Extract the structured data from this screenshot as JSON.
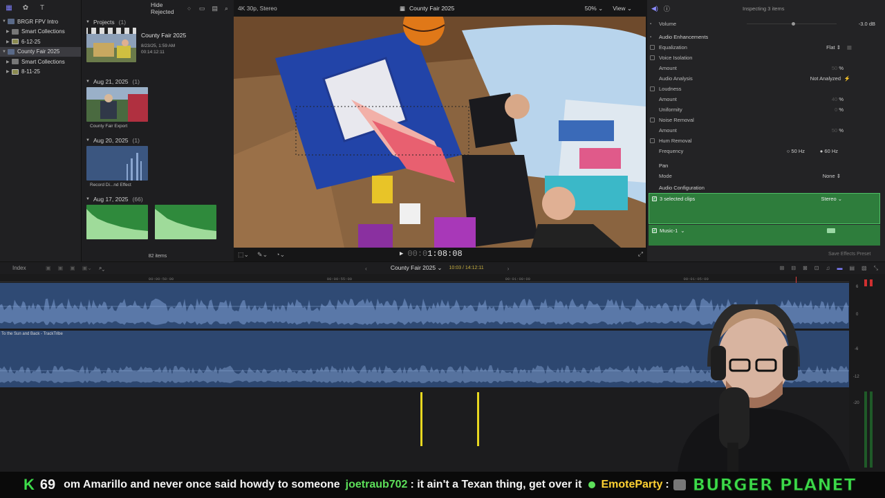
{
  "sidebar": {
    "items": [
      {
        "label": "BRGR FPV Intro",
        "type": "lib",
        "expanded": true
      },
      {
        "label": "Smart Collections",
        "type": "folder",
        "indent": true
      },
      {
        "label": "6-12-25",
        "type": "event",
        "indent": true
      },
      {
        "label": "County Fair 2025",
        "type": "lib",
        "selected": true
      },
      {
        "label": "Smart Collections",
        "type": "folder",
        "indent": true
      },
      {
        "label": "8-11-25",
        "type": "event",
        "indent": true
      }
    ]
  },
  "browser": {
    "hide_rejected": "Hide Rejected",
    "sections": [
      {
        "title": "Projects",
        "count": "(1)"
      },
      {
        "title": "Aug 21, 2025",
        "count": "(1)"
      },
      {
        "title": "Aug 20, 2025",
        "count": "(1)"
      },
      {
        "title": "Aug 17, 2025",
        "count": "(66)"
      }
    ],
    "project": {
      "title": "County Fair 2025",
      "date": "8/23/25, 1:59 AM",
      "duration": "00:14:12:11"
    },
    "clip_aug21": "County Fair Export",
    "clip_aug20": "Record Di...nd Effect",
    "items_count": "82 items"
  },
  "viewer": {
    "format": "4K 30p, Stereo",
    "title": "County Fair 2025",
    "zoom": "50%",
    "view": "View",
    "timecode_dim": "00:0",
    "timecode": "1:08:08"
  },
  "inspector": {
    "info": "Inspecting 3 items",
    "volume_label": "Volume",
    "volume_value": "-3.0",
    "volume_unit": "dB",
    "rows": {
      "enhancements": "Audio Enhancements",
      "equalization": "Equalization",
      "eq_value": "Flat",
      "voice_isolation": "Voice Isolation",
      "amount": "Amount",
      "amount_vi": "50",
      "audio_analysis": "Audio Analysis",
      "analysis_value": "Not Analyzed",
      "loudness": "Loudness",
      "amount_loud": "40",
      "uniformity": "Uniformity",
      "uniformity_value": "0",
      "noise_removal": "Noise Removal",
      "amount_noise": "50",
      "hum_removal": "Hum Removal",
      "frequency": "Frequency",
      "freq_50": "50 Hz",
      "freq_60": "60 Hz",
      "pan": "Pan",
      "mode": "Mode",
      "mode_value": "None",
      "audio_config": "Audio Configuration",
      "selected_clips": "3 selected clips",
      "stereo": "Stereo",
      "music": "Music-1",
      "percent": "%"
    },
    "save_preset": "Save Effects Preset",
    "volume_level": 0.52
  },
  "timeline": {
    "index": "Index",
    "project": "County Fair 2025",
    "position": "10:03 / 14:12:11",
    "ruler_ticks": [
      {
        "label": "00:00:50:00",
        "pos": 0.175
      },
      {
        "label": "00:00:55:00",
        "pos": 0.385
      },
      {
        "label": "00:01:00:00",
        "pos": 0.595
      },
      {
        "label": "00:01:05:00",
        "pos": 0.805
      }
    ],
    "audio_clip_name": "To the Sun and Back - TrackTribe",
    "meter_scale": [
      "6",
      "0",
      "-6",
      "-12",
      "-20"
    ]
  },
  "ticker": {
    "logo": "K",
    "count": "69",
    "message1": "om Amarillo and never once said howdy to someone",
    "user1": "joetraub702",
    "message2": ": it ain't a Texan thing, get over it",
    "user2": "EmoteParty",
    "message3": ":",
    "brand": "BURGER PLANET"
  },
  "colors": {
    "accent": "#7f7fff",
    "green_box": "#2e7d3c",
    "audio_blue": "#3e5a86",
    "marker": "#e8d820",
    "chat_green": "#3ddb4a"
  }
}
